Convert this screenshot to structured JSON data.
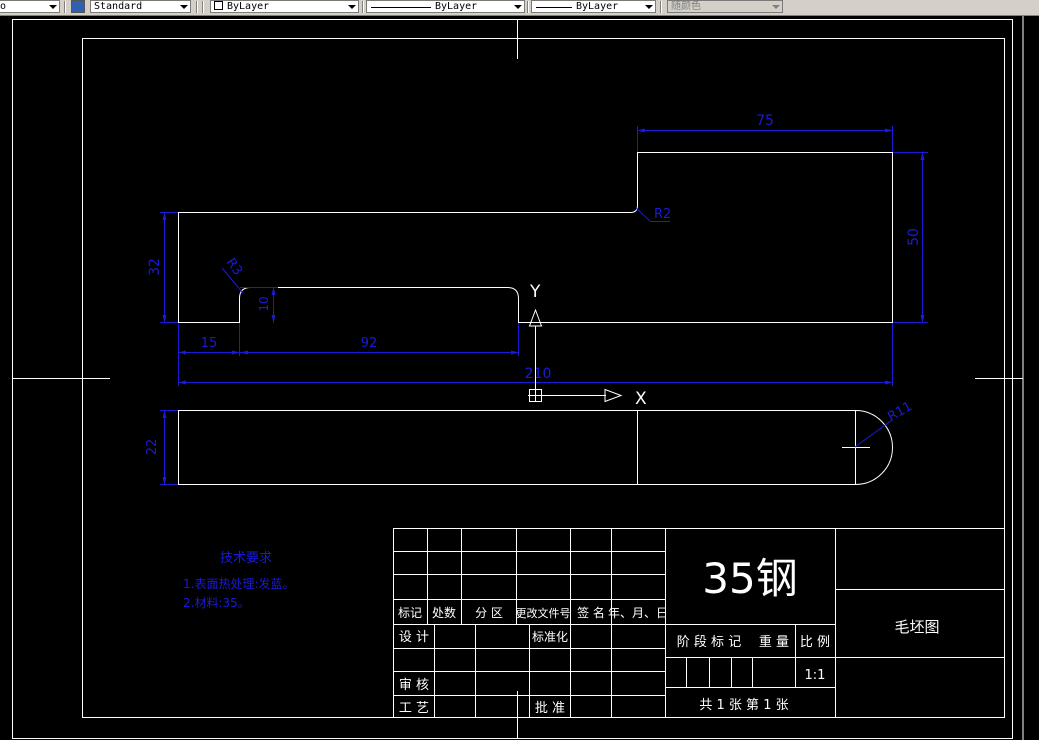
{
  "toolbar": {
    "textstyle_value": "Standard",
    "layer_value": "ByLayer",
    "linetype_value": "ByLayer",
    "lineweight_value": "ByLayer",
    "plotstyle_value": "随颜色",
    "left_fragment": "o"
  },
  "drawing": {
    "colors": {
      "background": "#000000",
      "geometry": "#ffffff",
      "dimension": "#1a1ad8"
    },
    "dimensions": {
      "top_width": "75",
      "fillet_r2": "R2",
      "right_height": "50",
      "left_height": "32",
      "slot_fillet": "R3",
      "slot_depth": "10",
      "left_offset": "15",
      "slot_length": "92",
      "overall_length": "210",
      "bottom_height": "22",
      "end_radius": "R11"
    },
    "ucs": {
      "x_label": "X",
      "y_label": "Y"
    },
    "notes": {
      "title": "技术要求",
      "line1": "1.表面热处理:发蓝。",
      "line2": "2.材料:35。"
    },
    "title_block": {
      "material": "35钢",
      "drawing_name": "毛坯图",
      "row_headers": [
        "标记",
        "处数",
        "分 区",
        "更改文件号",
        "签 名",
        "年、月、日"
      ],
      "design": "设 计",
      "standardize": "标准化",
      "review": "审 核",
      "process": "工 艺",
      "approve": "批 准",
      "stage_mark": "阶 段 标 记",
      "weight": "重 量",
      "scale_label": "比 例",
      "scale_value": "1:1",
      "sheet_info": "共 1 张   第 1 张"
    }
  }
}
